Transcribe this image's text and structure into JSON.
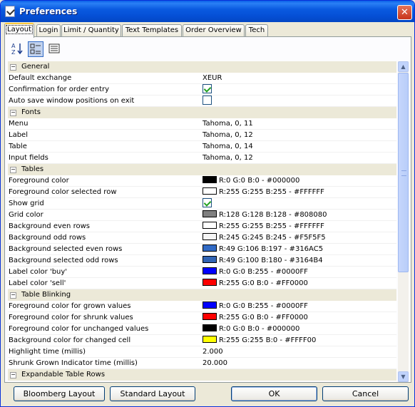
{
  "window": {
    "title": "Preferences",
    "close_glyph": "✕"
  },
  "tabs": [
    {
      "label": "Layout",
      "active": true
    },
    {
      "label": "Login"
    },
    {
      "label": "Limit / Quantity"
    },
    {
      "label": "Text Templates"
    },
    {
      "label": "Order Overview"
    },
    {
      "label": "Tech"
    }
  ],
  "toolbar": {
    "sort_alpha_icon": "sort-alphabetical-icon",
    "categorized_icon": "categorized-view-icon",
    "description_icon": "description-icon"
  },
  "categories": [
    {
      "label": "General",
      "toggle": "−",
      "rows": [
        {
          "name": "Default exchange",
          "value": "XEUR"
        },
        {
          "name": "Confirmation for order entry",
          "checkbox": true
        },
        {
          "name": "Auto save window positions on exit",
          "checkbox": false
        }
      ]
    },
    {
      "label": "Fonts",
      "toggle": "−",
      "rows": [
        {
          "name": "Menu",
          "value": "Tahoma, 0, 11"
        },
        {
          "name": "Label",
          "value": "Tahoma, 0, 12"
        },
        {
          "name": "Table",
          "value": "Tahoma, 0, 14"
        },
        {
          "name": "Input fields",
          "value": "Tahoma, 0, 12"
        }
      ]
    },
    {
      "label": "Tables",
      "toggle": "−",
      "rows": [
        {
          "name": "Foreground color",
          "color": "#000000",
          "value": "R:0 G:0 B:0 - #000000"
        },
        {
          "name": "Foreground color selected row",
          "color": "#FFFFFF",
          "value": "R:255 G:255 B:255 - #FFFFFF"
        },
        {
          "name": "Show grid",
          "checkbox": true
        },
        {
          "name": "Grid color",
          "color": "#808080",
          "value": "R:128 G:128 B:128 - #808080"
        },
        {
          "name": "Background even rows",
          "color": "#FFFFFF",
          "value": "R:255 G:255 B:255 - #FFFFFF"
        },
        {
          "name": "Background odd rows",
          "color": "#F5F5F5",
          "value": "R:245 G:245 B:245 - #F5F5F5"
        },
        {
          "name": "Background selected even rows",
          "color": "#316AC5",
          "value": "R:49 G:106 B:197 - #316AC5"
        },
        {
          "name": "Background selected odd rows",
          "color": "#3164B4",
          "value": "R:49 G:100 B:180 - #3164B4"
        },
        {
          "name": "Label color 'buy'",
          "color": "#0000FF",
          "value": "R:0 G:0 B:255 - #0000FF"
        },
        {
          "name": "Label color 'sell'",
          "color": "#FF0000",
          "value": "R:255 G:0 B:0 - #FF0000"
        }
      ]
    },
    {
      "label": "Table Blinking",
      "toggle": "−",
      "rows": [
        {
          "name": "Foreground color for grown values",
          "color": "#0000FF",
          "value": "R:0 G:0 B:255 - #0000FF"
        },
        {
          "name": "Foreground color for shrunk values",
          "color": "#FF0000",
          "value": "R:255 G:0 B:0 - #FF0000"
        },
        {
          "name": "Foreground color for unchanged values",
          "color": "#000000",
          "value": "R:0 G:0 B:0 - #000000"
        },
        {
          "name": "Background color for changed cell",
          "color": "#FFFF00",
          "value": "R:255 G:255 B:0 - #FFFF00"
        },
        {
          "name": "Highlight time (millis)",
          "value": "2.000"
        },
        {
          "name": "Shrunk Grown Indicator time (millis)",
          "value": "20.000"
        }
      ]
    },
    {
      "label": "Expandable Table Rows",
      "toggle": "−",
      "rows": []
    }
  ],
  "scrollbar": {
    "up_glyph": "▲",
    "down_glyph": "▼"
  },
  "buttons": {
    "bloomberg_layout": "Bloomberg Layout",
    "standard_layout": "Standard Layout",
    "ok": "OK",
    "cancel": "Cancel"
  }
}
